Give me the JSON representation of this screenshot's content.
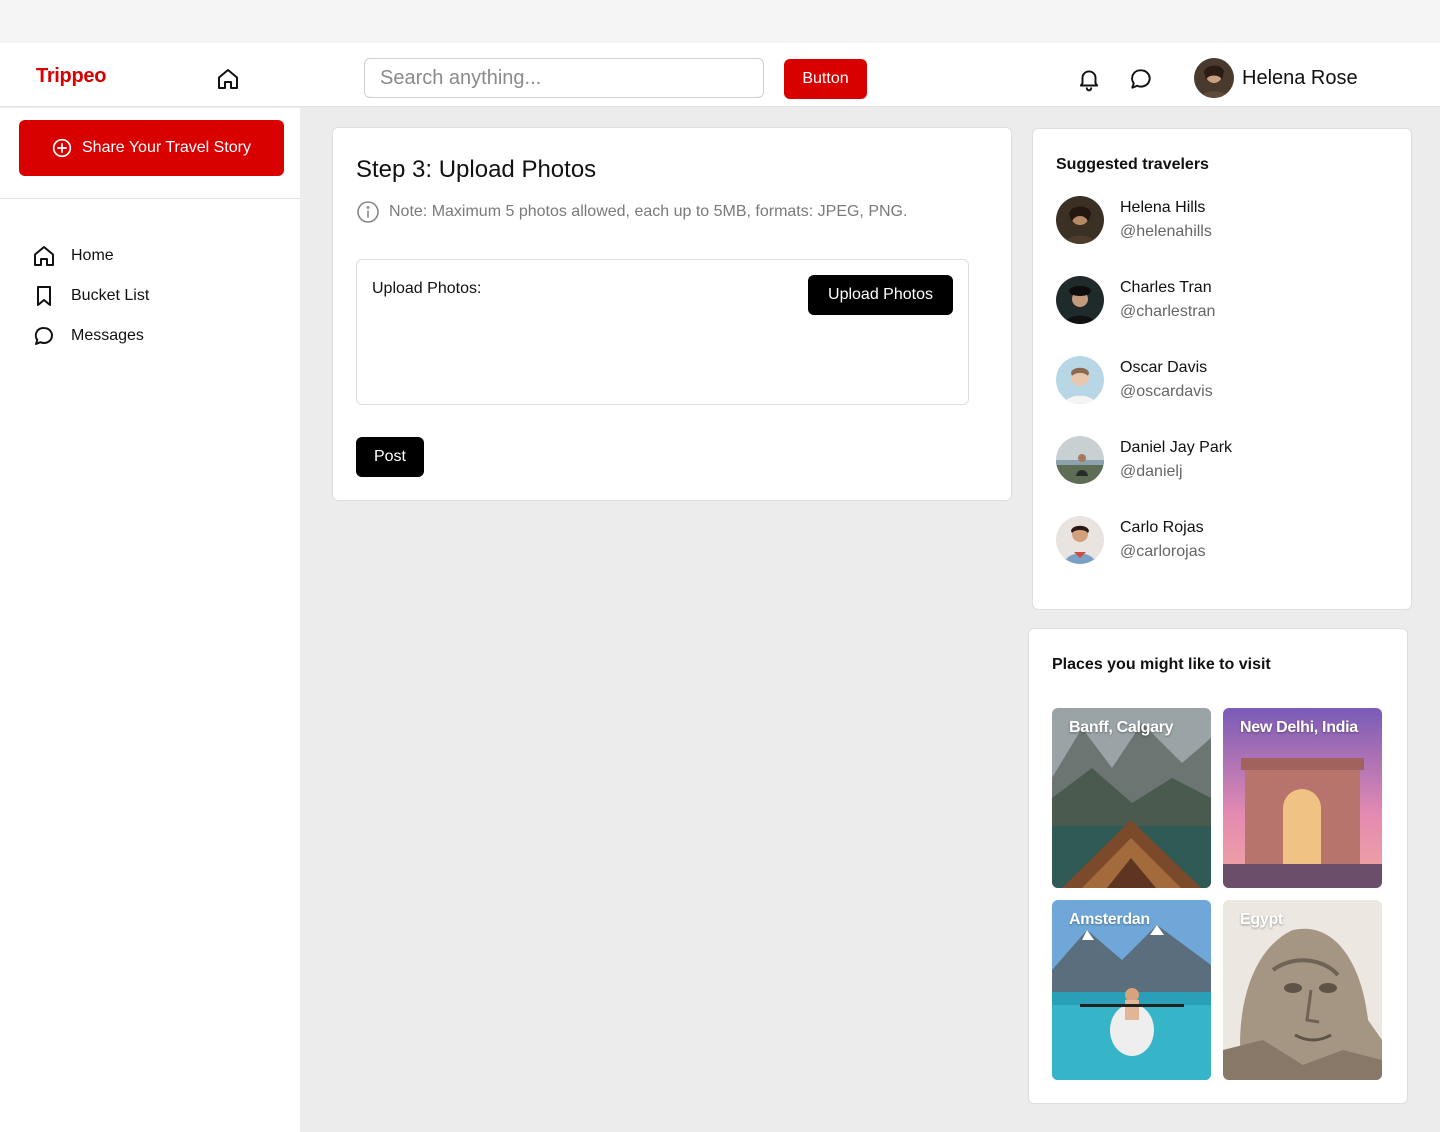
{
  "app": {
    "logo": "Trippeo"
  },
  "header": {
    "search_placeholder": "Search anything...",
    "button_label": "Button",
    "user_name": "Helena Rose"
  },
  "sidebar": {
    "share_label": "Share Your Travel Story",
    "nav": [
      {
        "label": "Home",
        "icon": "home-icon"
      },
      {
        "label": "Bucket List",
        "icon": "bookmark-icon"
      },
      {
        "label": "Messages",
        "icon": "message-icon"
      }
    ]
  },
  "main": {
    "title": "Step 3: Upload Photos",
    "note": "Note: Maximum 5 photos allowed, each up to 5MB, formats: JPEG, PNG.",
    "upload_label": "Upload Photos:",
    "upload_button": "Upload Photos",
    "post_button": "Post"
  },
  "suggested": {
    "title": "Suggested travelers",
    "travelers": [
      {
        "name": "Helena Hills",
        "handle": "@helenahills"
      },
      {
        "name": "Charles Tran",
        "handle": "@charlestran"
      },
      {
        "name": "Oscar Davis",
        "handle": "@oscardavis"
      },
      {
        "name": "Daniel Jay Park",
        "handle": "@danielj"
      },
      {
        "name": "Carlo Rojas",
        "handle": "@carlorojas"
      }
    ]
  },
  "places": {
    "title": "Places you might like to visit",
    "items": [
      {
        "label": "Banff, Calgary"
      },
      {
        "label": "New Delhi, India"
      },
      {
        "label": "Amsterdan"
      },
      {
        "label": "Egypt"
      }
    ]
  },
  "colors": {
    "brand": "#d90000",
    "dark_button": "#000000",
    "page_bg": "#ececec"
  }
}
